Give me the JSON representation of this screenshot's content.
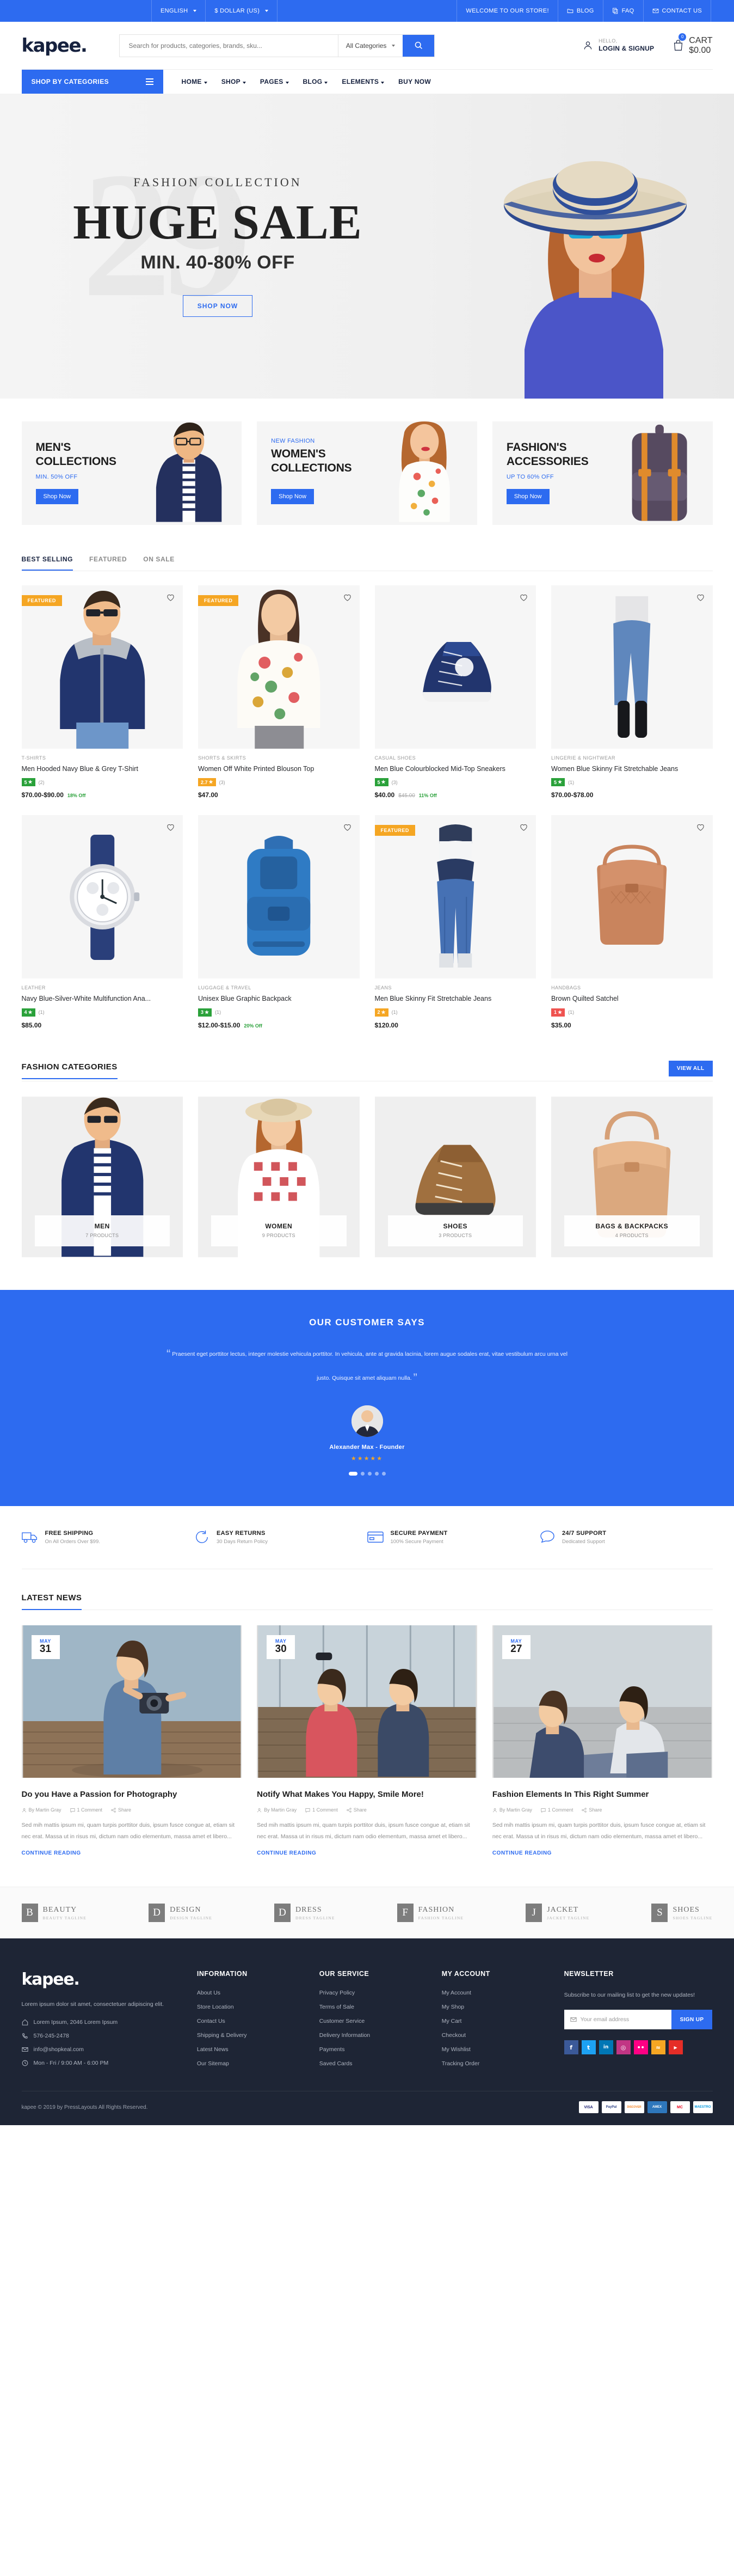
{
  "topbar": {
    "language": "ENGLISH",
    "currency": "$ DOLLAR (US)",
    "welcome": "WELCOME TO OUR STORE!",
    "blog": "BLOG",
    "faq": "FAQ",
    "contact": "CONTACT US"
  },
  "header": {
    "logo": "kapee.",
    "search_placeholder": "Search for products, categories, brands, sku...",
    "categories_label": "All Categories",
    "account_small": "HELLO,",
    "account_big": "LOGIN & SIGNUP",
    "cart_small": "CART",
    "cart_total": "$0.00",
    "cart_count": "0"
  },
  "nav": {
    "shop_by_categories": "SHOP BY CATEGORIES",
    "items": [
      {
        "label": "HOME",
        "caret": true
      },
      {
        "label": "SHOP",
        "caret": true
      },
      {
        "label": "PAGES",
        "caret": true
      },
      {
        "label": "BLOG",
        "caret": true
      },
      {
        "label": "ELEMENTS",
        "caret": true
      },
      {
        "label": "BUY NOW",
        "caret": false
      }
    ]
  },
  "hero": {
    "ghost": "29",
    "kicker": "FASHION COLLECTION",
    "title": "HUGE SALE",
    "subtitle": "MIN. 40-80% OFF",
    "button": "SHOP NOW"
  },
  "promos": [
    {
      "tag": "",
      "title_line1": "MEN'S",
      "title_line2": "COLLECTIONS",
      "off": "MIN. 50% OFF",
      "button": "Shop Now"
    },
    {
      "tag": "NEW FASHION",
      "title_line1": "WOMEN'S",
      "title_line2": "COLLECTIONS",
      "off": "",
      "button": "Shop Now"
    },
    {
      "tag": "",
      "title_line1": "FASHION'S",
      "title_line2": "ACCESSORIES",
      "off": "UP TO 60% OFF",
      "button": "Shop Now"
    }
  ],
  "product_tabs": [
    {
      "label": "BEST SELLING",
      "active": true
    },
    {
      "label": "FEATURED",
      "active": false
    },
    {
      "label": "ON SALE",
      "active": false
    }
  ],
  "products": [
    {
      "badge": "FEATURED",
      "category": "T-SHIRTS",
      "name": "Men Hooded Navy Blue & Grey T-Shirt",
      "rating": "5",
      "rating_color": "#2aa13a",
      "reviews": "(2)",
      "price": "$70.00-$90.00",
      "old_price": "",
      "discount": "18% Off"
    },
    {
      "badge": "FEATURED",
      "category": "SHORTS & SKIRTS",
      "name": "Women Off White Printed Blouson Top",
      "rating": "2.7",
      "rating_color": "#f5a623",
      "reviews": "(3)",
      "price": "$47.00",
      "old_price": "",
      "discount": ""
    },
    {
      "badge": "",
      "category": "CASUAL SHOES",
      "name": "Men Blue Colourblocked Mid-Top Sneakers",
      "rating": "5",
      "rating_color": "#2aa13a",
      "reviews": "(3)",
      "price": "$40.00",
      "old_price": "$45.00",
      "discount": "11% Off"
    },
    {
      "badge": "",
      "category": "LINGERIE & NIGHTWEAR",
      "name": "Women Blue Skinny Fit Stretchable Jeans",
      "rating": "5",
      "rating_color": "#2aa13a",
      "reviews": "(1)",
      "price": "$70.00-$78.00",
      "old_price": "",
      "discount": ""
    },
    {
      "badge": "",
      "category": "LEATHER",
      "name": "Navy Blue-Silver-White Multifunction Ana...",
      "rating": "4",
      "rating_color": "#2aa13a",
      "reviews": "(1)",
      "price": "$85.00",
      "old_price": "",
      "discount": ""
    },
    {
      "badge": "",
      "category": "LUGGAGE & TRAVEL",
      "name": "Unisex Blue Graphic Backpack",
      "rating": "3",
      "rating_color": "#2aa13a",
      "reviews": "(1)",
      "price": "$12.00-$15.00",
      "old_price": "",
      "discount": "20% Off"
    },
    {
      "badge": "FEATURED",
      "category": "JEANS",
      "name": "Men Blue Skinny Fit Stretchable Jeans",
      "rating": "2",
      "rating_color": "#f5a623",
      "reviews": "(1)",
      "price": "$120.00",
      "old_price": "",
      "discount": ""
    },
    {
      "badge": "",
      "category": "HANDBAGS",
      "name": "Brown Quilted Satchel",
      "rating": "1",
      "rating_color": "#ef5350",
      "reviews": "(1)",
      "price": "$35.00",
      "old_price": "",
      "discount": ""
    }
  ],
  "categories_section": {
    "title": "FASHION CATEGORIES",
    "view_all": "VIEW ALL",
    "items": [
      {
        "name": "MEN",
        "count": "7 PRODUCTS"
      },
      {
        "name": "WOMEN",
        "count": "9 PRODUCTS"
      },
      {
        "name": "SHOES",
        "count": "3 PRODUCTS"
      },
      {
        "name": "BAGS & BACKPACKS",
        "count": "4 PRODUCTS"
      }
    ]
  },
  "testimonial": {
    "heading": "OUR CUSTOMER SAYS",
    "quote": "Praesent eget porttitor lectus, integer molestie vehicula porttitor. In vehicula, ante at gravida lacinia, lorem augue sodales erat, vitae vestibulum arcu urna vel justo. Quisque sit amet aliquam nulla.",
    "name": "Alexander Max",
    "role": "Founder",
    "stars": "★★★★★"
  },
  "services": [
    {
      "icon": "truck-icon",
      "title": "FREE SHIPPING",
      "sub": "On All Orders Over $99."
    },
    {
      "icon": "returns-icon",
      "title": "EASY RETURNS",
      "sub": "30 Days Return Policy"
    },
    {
      "icon": "card-icon",
      "title": "SECURE PAYMENT",
      "sub": "100% Secure Payment"
    },
    {
      "icon": "support-icon",
      "title": "24/7 SUPPORT",
      "sub": "Dedicated Support"
    }
  ],
  "news_section": {
    "title": "LATEST NEWS",
    "posts": [
      {
        "month": "MAY",
        "day": "31",
        "title": "Do you Have a Passion for Photography",
        "author": "By Martin Gray",
        "comments": "1 Comment",
        "share": "Share",
        "excerpt": "Sed mih mattis ipsum mi, quam turpis porttitor duis, ipsum fusce congue at, etiam sit nec erat. Massa ut in risus mi, dictum nam odio elementum, massa amet et libero...",
        "more": "CONTINUE READING"
      },
      {
        "month": "MAY",
        "day": "30",
        "title": "Notify What Makes You Happy, Smile More!",
        "author": "By Martin Gray",
        "comments": "1 Comment",
        "share": "Share",
        "excerpt": "Sed mih mattis ipsum mi, quam turpis porttitor duis, ipsum fusce congue at, etiam sit nec erat. Massa ut in risus mi, dictum nam odio elementum, massa amet et libero...",
        "more": "CONTINUE READING"
      },
      {
        "month": "MAY",
        "day": "27",
        "title": "Fashion Elements In This Right Summer",
        "author": "By Martin Gray",
        "comments": "1 Comment",
        "share": "Share",
        "excerpt": "Sed mih mattis ipsum mi, quam turpis porttitor duis, ipsum fusce congue at, etiam sit nec erat. Massa ut in risus mi, dictum nam odio elementum, massa amet et libero...",
        "more": "CONTINUE READING"
      }
    ]
  },
  "brands": [
    {
      "mark": "B",
      "name": "BEAUTY",
      "tagline": "BEAUTY TAGLINE"
    },
    {
      "mark": "D",
      "name": "DESIGN",
      "tagline": "DESIGN TAGLINE"
    },
    {
      "mark": "D",
      "name": "DRESS",
      "tagline": "DRESS TAGLINE"
    },
    {
      "mark": "F",
      "name": "FASHION",
      "tagline": "FASHION TAGLINE"
    },
    {
      "mark": "J",
      "name": "JACKET",
      "tagline": "JACKET TAGLINE"
    },
    {
      "mark": "S",
      "name": "SHOES",
      "tagline": "SHOES TAGLINE"
    }
  ],
  "footer": {
    "logo": "kapee.",
    "about": "Lorem ipsum dolor sit amet, consectetuer adipiscing elit.",
    "address": "Lorem Ipsum, 2046 Lorem Ipsum",
    "phone": "576-245-2478",
    "email": "info@shopkeal.com",
    "hours": "Mon - Fri / 9:00 AM - 6:00 PM",
    "col_information": {
      "title": "INFORMATION",
      "links": [
        "About Us",
        "Store Location",
        "Contact Us",
        "Shipping & Delivery",
        "Latest News",
        "Our Sitemap"
      ]
    },
    "col_service": {
      "title": "OUR SERVICE",
      "links": [
        "Privacy Policy",
        "Terms of Sale",
        "Customer Service",
        "Delivery Information",
        "Payments",
        "Saved Cards"
      ]
    },
    "col_account": {
      "title": "MY ACCOUNT",
      "links": [
        "My Account",
        "My Shop",
        "My Cart",
        "Checkout",
        "My Wishlist",
        "Tracking Order"
      ]
    },
    "newsletter": {
      "title": "NEWSLETTER",
      "text": "Subscribe to our mailing list to get the new updates!",
      "placeholder": "Your email address",
      "button": "SIGN UP"
    },
    "socials": [
      {
        "name": "facebook-icon",
        "glyph": "f",
        "color": "#3b5998"
      },
      {
        "name": "twitter-icon",
        "glyph": "t",
        "color": "#1da1f2"
      },
      {
        "name": "linkedin-icon",
        "glyph": "in",
        "color": "#0077b5"
      },
      {
        "name": "instagram-icon",
        "glyph": "◎",
        "color": "#c13584"
      },
      {
        "name": "flickr-icon",
        "glyph": "•",
        "color": "#ff0084"
      },
      {
        "name": "rss-icon",
        "glyph": "≈",
        "color": "#f5a623"
      },
      {
        "name": "youtube-icon",
        "glyph": "▶",
        "color": "#e52d27"
      }
    ],
    "copyright": "kapee © 2019 by PressLayouts All Rights Reserved.",
    "payments": [
      "VISA",
      "PayPal",
      "DISCOVER",
      "AMEX",
      "MC",
      "MAESTRO"
    ]
  },
  "colors": {
    "primary": "#2d6bf0",
    "orange": "#f5a623",
    "green": "#2aa13a",
    "dark": "#1e2535"
  }
}
